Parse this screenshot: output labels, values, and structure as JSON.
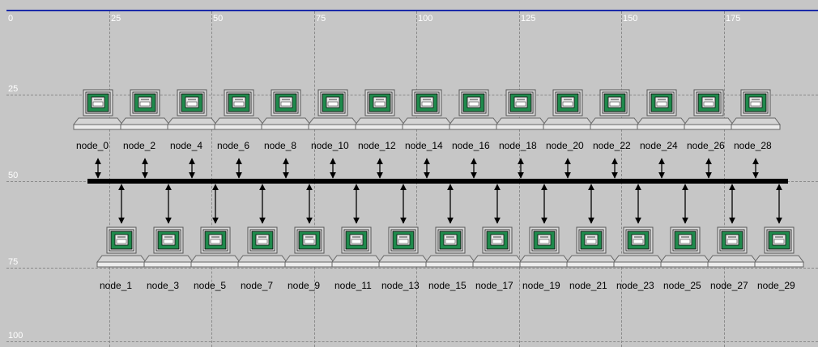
{
  "ruler": {
    "x_ticks": [
      "0",
      "25",
      "50",
      "75",
      "100",
      "125",
      "150",
      "175"
    ],
    "y_ticks": [
      "25",
      "50",
      "75",
      "100"
    ]
  },
  "top_row_nodes": [
    "node_0",
    "node_2",
    "node_4",
    "node_6",
    "node_8",
    "node_10",
    "node_12",
    "node_14",
    "node_16",
    "node_18",
    "node_20",
    "node_22",
    "node_24",
    "node_26",
    "node_28"
  ],
  "bottom_row_nodes": [
    "node_1",
    "node_3",
    "node_5",
    "node_7",
    "node_9",
    "node_11",
    "node_13",
    "node_15",
    "node_17",
    "node_19",
    "node_21",
    "node_23",
    "node_25",
    "node_27",
    "node_29"
  ],
  "colors": {
    "background": "#c6c6c6",
    "bus": "#000000",
    "screen": "#1f8a4c",
    "top_border": "#1a2aa8"
  }
}
